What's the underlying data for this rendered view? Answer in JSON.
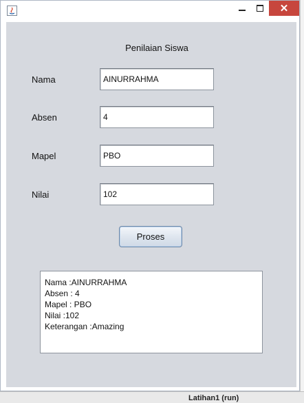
{
  "window": {
    "close_symbol": "✕"
  },
  "form": {
    "title": "Penilaian Siswa",
    "fields": [
      {
        "label": "Nama",
        "value": "AINURRAHMA"
      },
      {
        "label": "Absen",
        "value": "4"
      },
      {
        "label": "Mapel",
        "value": "PBO"
      },
      {
        "label": "Nilai",
        "value": "102"
      }
    ],
    "button_label": "Proses"
  },
  "output": {
    "lines": [
      "Nama :AINURRAHMA",
      "Absen : 4",
      "Mapel : PBO",
      "Nilai :102",
      "Keterangan :Amazing"
    ]
  },
  "background": {
    "tab_label": "Latihan1 (run)"
  },
  "colors": {
    "panel": "#d6d9df",
    "close_button": "#c7463d"
  }
}
